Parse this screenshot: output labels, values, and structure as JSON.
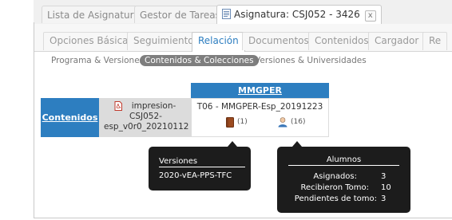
{
  "top_tabs": [
    {
      "label": "Lista de Asignaturas"
    },
    {
      "label": "Gestor de Tareas"
    },
    {
      "label": "Asignatura: CSJ052 - 3426",
      "close": "x"
    }
  ],
  "secondary_tabs": [
    {
      "label": "Opciones Básicas"
    },
    {
      "label": "Seguimiento"
    },
    {
      "label": "Relación"
    },
    {
      "label": "Documentos"
    },
    {
      "label": "Contenidos"
    },
    {
      "label": "Cargador"
    },
    {
      "label": "Re"
    }
  ],
  "subnav": {
    "items": [
      "Programa & Versiones",
      "Contenidos & Colecciones",
      "Versiones & Universidades"
    ]
  },
  "table": {
    "column_header": "MMGPER",
    "row_header": "Contenidos",
    "file_name": [
      "impresion-",
      "CSJ052-",
      "esp_v0r0_20210112"
    ],
    "record_title": "T06 - MMGPER-Esp_20191223",
    "book_count": "(1)",
    "user_count": "(16)"
  },
  "tooltip_versiones": {
    "title": "Versiones",
    "value": "2020-vEA-PPS-TFC"
  },
  "tooltip_alumnos": {
    "title": "Alumnos",
    "rows": [
      {
        "label": "Asignados:",
        "value": "3"
      },
      {
        "label": "Recibieron Tomo:",
        "value": "10"
      },
      {
        "label": "Pendientes de tomo:",
        "value": "3"
      }
    ]
  },
  "colors": {
    "accent_blue": "#2d7ec0",
    "tooltip_bg": "#1c1c1c",
    "pill_gray": "#7e7e7e"
  }
}
